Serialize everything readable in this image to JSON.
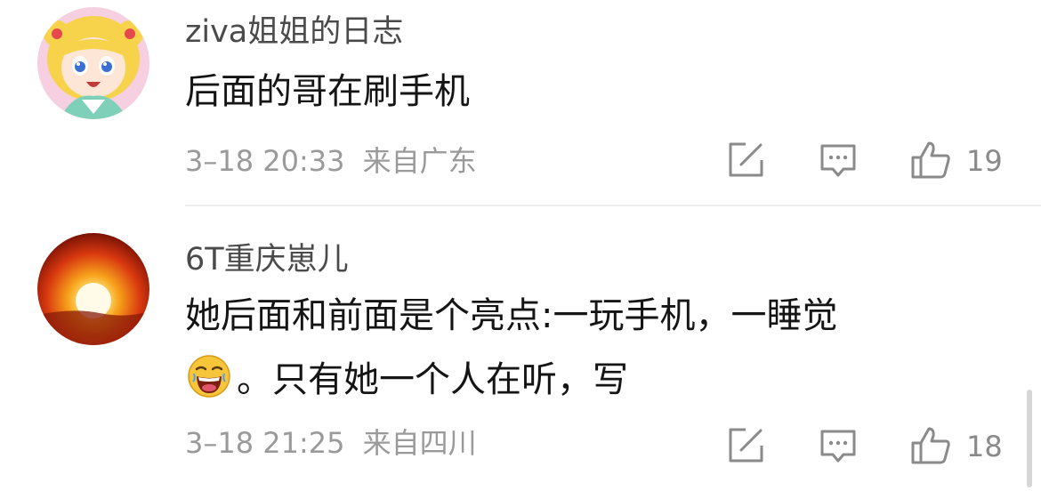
{
  "comments": [
    {
      "username": "ziva姐姐的日志",
      "text_line1": "后面的哥在刷手机",
      "date": "3–18 20:33",
      "location": "来自广东",
      "likes": "19",
      "avatar_icon": "cartoon-girl-avatar"
    },
    {
      "username": "6T重庆崽儿",
      "text_line1": "她后面和前面是个亮点:一玩手机，一睡觉",
      "text_line2": "。只有她一个人在听，写",
      "emoji_icon": "laughing-emoji-icon",
      "date": "3–18 21:25",
      "location": "来自四川",
      "likes": "18",
      "avatar_icon": "sunset-avatar"
    }
  ],
  "colors": {
    "username": "#4a4a4a",
    "text": "#151515",
    "meta": "#9a9a9a",
    "divider": "#eeeeee"
  }
}
